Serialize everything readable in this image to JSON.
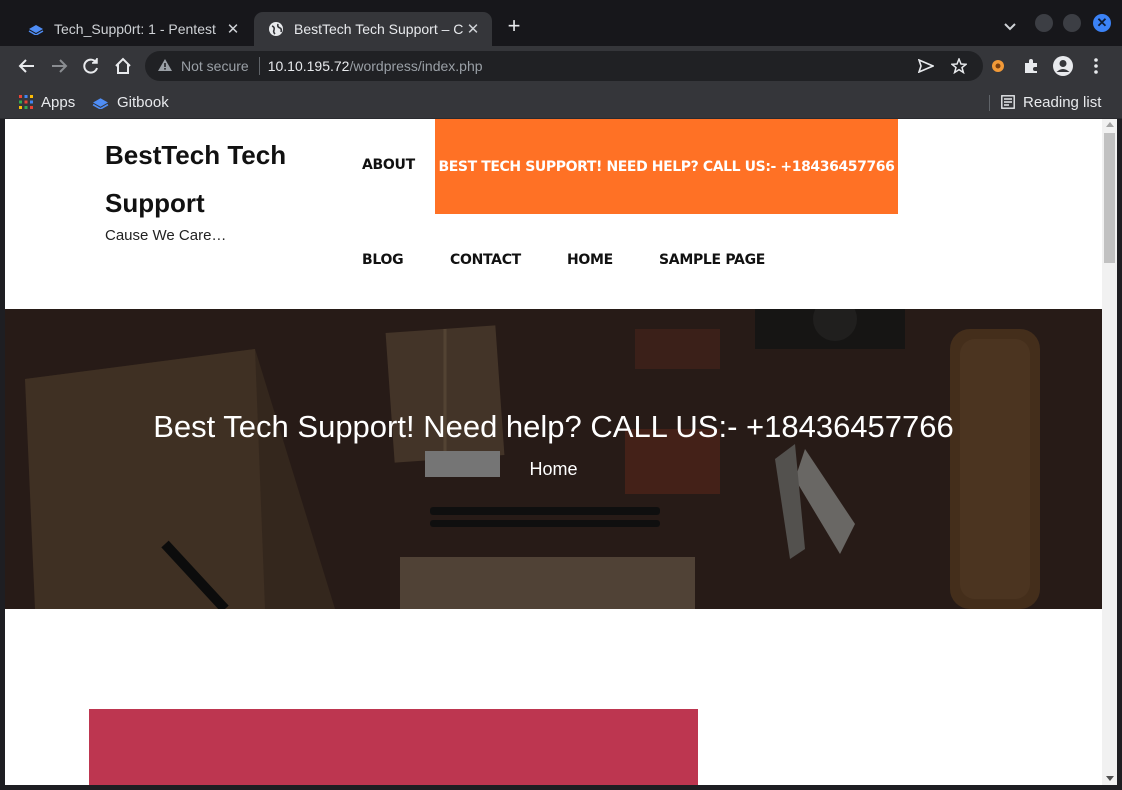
{
  "browser": {
    "tabs": [
      {
        "title": "Tech_Supp0rt: 1 - Pentest",
        "active": false,
        "favicon": "gitbook-icon"
      },
      {
        "title": "BestTech Tech Support – C",
        "active": true,
        "favicon": "globe-icon"
      }
    ],
    "security_label": "Not secure",
    "url_host": "10.10.195.72",
    "url_path": "/wordpress/index.php",
    "bookmarks": [
      {
        "label": "Apps",
        "icon": "apps-grid-icon"
      },
      {
        "label": "Gitbook",
        "icon": "gitbook-icon"
      }
    ],
    "reading_list": "Reading list",
    "accent_color": "#3b82f6"
  },
  "site": {
    "title": "BestTech Tech Support",
    "tagline": "Cause We Care…",
    "nav": {
      "about": "ABOUT",
      "blog": "BLOG",
      "contact": "CONTACT",
      "home": "HOME",
      "sample": "SAMPLE PAGE"
    },
    "cta": "BEST TECH SUPPORT! NEED HELP? CALL US:- +18436457766",
    "cta_color": "#ff7125",
    "hero": {
      "title": "Best Tech Support! Need help? CALL US:- +18436457766",
      "breadcrumb": "Home"
    },
    "card_color": "#bd3650"
  }
}
